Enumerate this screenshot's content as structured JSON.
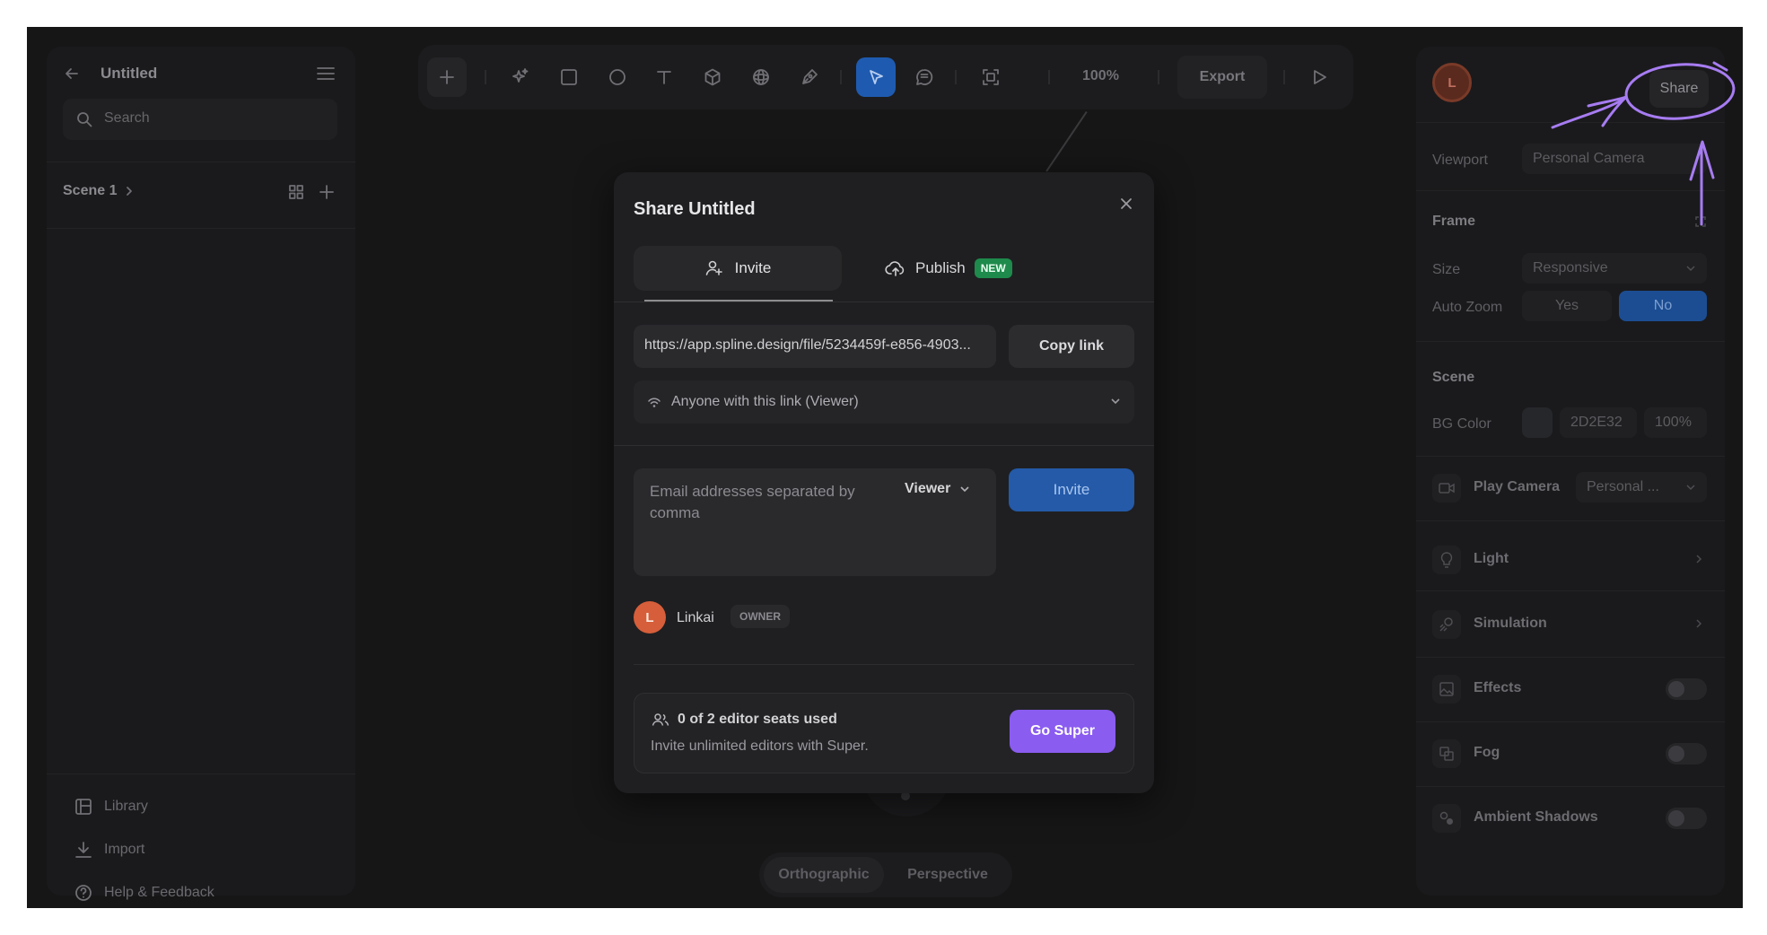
{
  "app": {
    "file_title": "Untitled"
  },
  "left_panel": {
    "search_placeholder": "Search",
    "scene_label": "Scene 1",
    "footer": [
      {
        "label": "Library",
        "icon": "library-icon"
      },
      {
        "label": "Import",
        "icon": "import-icon"
      },
      {
        "label": "Help & Feedback",
        "icon": "help-icon"
      }
    ]
  },
  "toolbar": {
    "zoom": "100%",
    "export_label": "Export",
    "active_tool": "select"
  },
  "right_panel": {
    "avatar_initial": "L",
    "share_label": "Share",
    "viewport_label": "Viewport",
    "viewport_value": "Personal Camera",
    "frame_section": "Frame",
    "size_label": "Size",
    "size_value": "Responsive",
    "autozoom_label": "Auto Zoom",
    "autozoom_yes": "Yes",
    "autozoom_no": "No",
    "scene_section": "Scene",
    "bgcolor_label": "BG Color",
    "bgcolor_hex": "2D2E32",
    "bgcolor_opacity": "100%",
    "play_camera_label": "Play Camera",
    "play_camera_value": "Personal ...",
    "light_label": "Light",
    "simulation_label": "Simulation",
    "effects_label": "Effects",
    "fog_label": "Fog",
    "ambient_shadows_label": "Ambient Shadows"
  },
  "canvas": {
    "view_orthographic": "Orthographic",
    "view_perspective": "Perspective"
  },
  "share_modal": {
    "title": "Share Untitled",
    "tab_invite": "Invite",
    "tab_publish": "Publish",
    "publish_badge": "NEW",
    "link_url": "https://app.spline.design/file/5234459f-e856-4903...",
    "copy_link_label": "Copy link",
    "access_label": "Anyone with this link (Viewer)",
    "email_placeholder": "Email addresses separated by comma",
    "role_value": "Viewer",
    "invite_label": "Invite",
    "owner_initial": "L",
    "owner_name": "Linkai",
    "owner_badge": "OWNER",
    "seats_title": "0 of 2 editor seats used",
    "seats_subtitle": "Invite unlimited editors with Super.",
    "go_super_label": "Go Super"
  },
  "colors": {
    "accent_blue": "#245aa8",
    "super_purple": "#8a5cf0",
    "new_badge_green": "#1e8a4c",
    "avatar_orange": "#d65e3a",
    "annotation_purple": "#a77cf2"
  }
}
